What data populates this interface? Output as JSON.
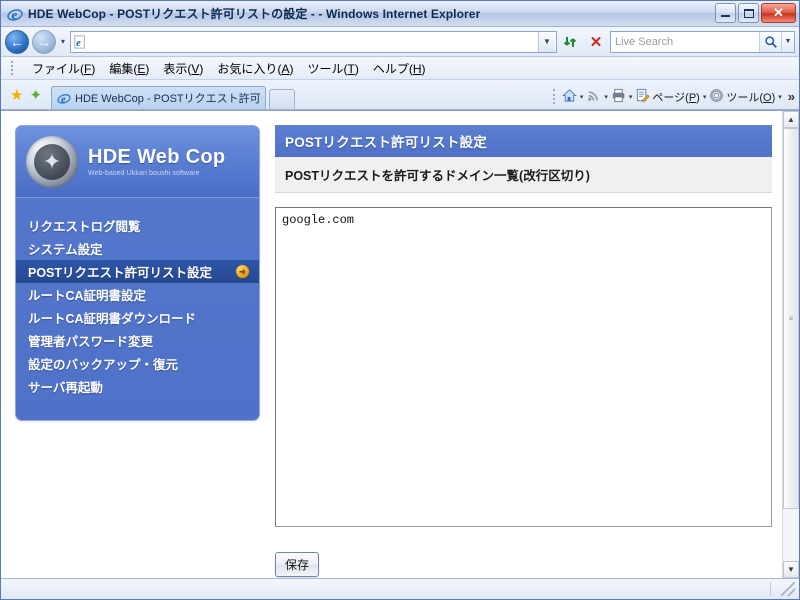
{
  "window": {
    "title": "HDE WebCop - POSTリクエスト許可リストの設定 - - Windows Internet Explorer",
    "app_icon": "internet-explorer-icon",
    "minimize_label": "—",
    "maximize_label": "□",
    "close_label": "✕"
  },
  "nav_toolbar": {
    "back_label": "←",
    "forward_label": "→",
    "recent_dropdown_label": "▾",
    "address_value": "",
    "address_placeholder": "",
    "address_favicon": "internet-explorer-icon",
    "address_dropdown_label": "▼",
    "refresh_label": "⇄",
    "stop_label": "✕",
    "search_value": "",
    "search_placeholder": "Live Search",
    "search_go_label": "🔍",
    "search_dropdown_label": "▼"
  },
  "menubar": {
    "items": [
      {
        "label": "ファイル",
        "mnemonic": "F"
      },
      {
        "label": "編集",
        "mnemonic": "E"
      },
      {
        "label": "表示",
        "mnemonic": "V"
      },
      {
        "label": "お気に入り",
        "mnemonic": "A"
      },
      {
        "label": "ツール",
        "mnemonic": "T"
      },
      {
        "label": "ヘルプ",
        "mnemonic": "H"
      }
    ]
  },
  "tabbar": {
    "favorites_center_icon": "star-icon",
    "add_favorite_icon": "add-favorite-icon",
    "tab_label": "HDE WebCop - POSTリクエスト許可リストの設定 -",
    "tab_favicon": "internet-explorer-icon",
    "new_tab_label": ""
  },
  "commandbar": {
    "items": [
      {
        "name": "home",
        "icon": "home-icon",
        "glyph": "⌂",
        "label": "",
        "mnemonic": "",
        "caret": "▾"
      },
      {
        "name": "feeds",
        "icon": "rss-icon",
        "glyph": "◉",
        "label": "",
        "mnemonic": "",
        "caret": "▾"
      },
      {
        "name": "print",
        "icon": "printer-icon",
        "glyph": "⎙",
        "label": "",
        "mnemonic": "",
        "caret": "▾"
      },
      {
        "name": "page",
        "icon": "page-icon",
        "glyph": "▤",
        "label": "ページ",
        "mnemonic": "P",
        "caret": "▾"
      },
      {
        "name": "tools",
        "icon": "gear-icon",
        "glyph": "✿",
        "label": "ツール",
        "mnemonic": "O",
        "caret": "▾"
      }
    ],
    "overflow_label": "»"
  },
  "sidebar": {
    "brand_title": "HDE Web Cop",
    "brand_subtitle": "Web-based Ukkari boushi software",
    "brand_logo": "shield-star-medal-icon",
    "items": [
      {
        "label": "リクエストログ閲覧",
        "active": false
      },
      {
        "label": "システム設定",
        "active": false
      },
      {
        "label": "POSTリクエスト許可リスト設定",
        "active": true,
        "arrow": "➜"
      },
      {
        "label": "ルートCA証明書設定",
        "active": false
      },
      {
        "label": "ルートCA証明書ダウンロード",
        "active": false
      },
      {
        "label": "管理者パスワード変更",
        "active": false
      },
      {
        "label": "設定のバックアップ・復元",
        "active": false
      },
      {
        "label": "サーバ再起動",
        "active": false
      }
    ]
  },
  "content": {
    "title": "POSTリクエスト許可リスト設定",
    "field_label": "POSTリクエストを許可するドメイン一覧(改行区切り)",
    "textarea_value": "google.com",
    "textarea_placeholder": "",
    "save_label": "保存"
  },
  "page_scrollbar": {
    "up_label": "▲",
    "down_label": "▼",
    "grip_label": "≡"
  },
  "statusbar": {
    "status_text": "",
    "zone_text": "",
    "zoom_text": ""
  }
}
